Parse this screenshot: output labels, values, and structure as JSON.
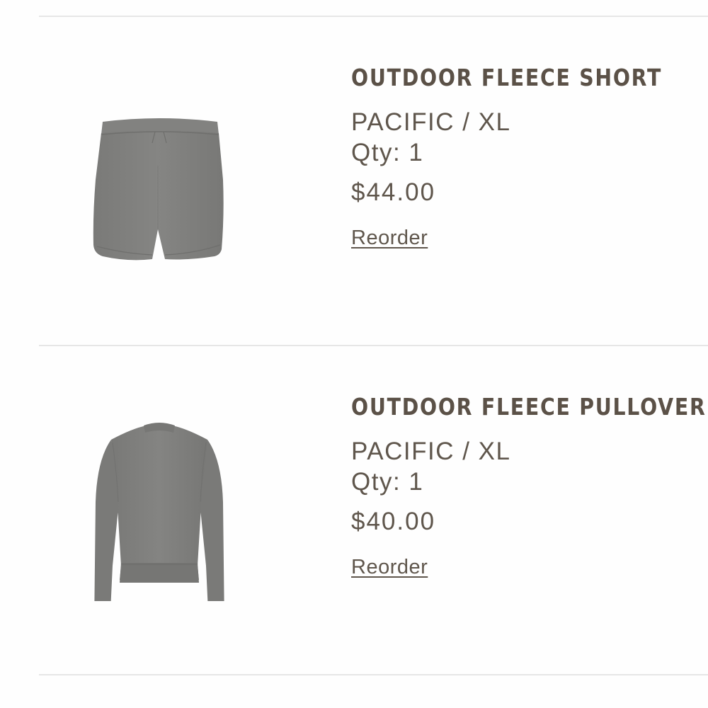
{
  "orders": {
    "reorder_label": "Reorder",
    "items": [
      {
        "name": "OUTDOOR FLEECE SHORT",
        "variant": "PACIFIC / XL",
        "quantity": "Qty: 1",
        "price": "$44.00",
        "image_icon": "fleece-shorts-image",
        "product_color": "#7f7f7d"
      },
      {
        "name": "OUTDOOR FLEECE PULLOVER",
        "variant": "PACIFIC / XL",
        "quantity": "Qty: 1",
        "price": "$40.00",
        "image_icon": "fleece-pullover-image",
        "product_color": "#7f7f7d"
      }
    ]
  },
  "colors": {
    "text": "#5a5148",
    "divider": "#e6e6e6",
    "background": "#fefefe"
  }
}
